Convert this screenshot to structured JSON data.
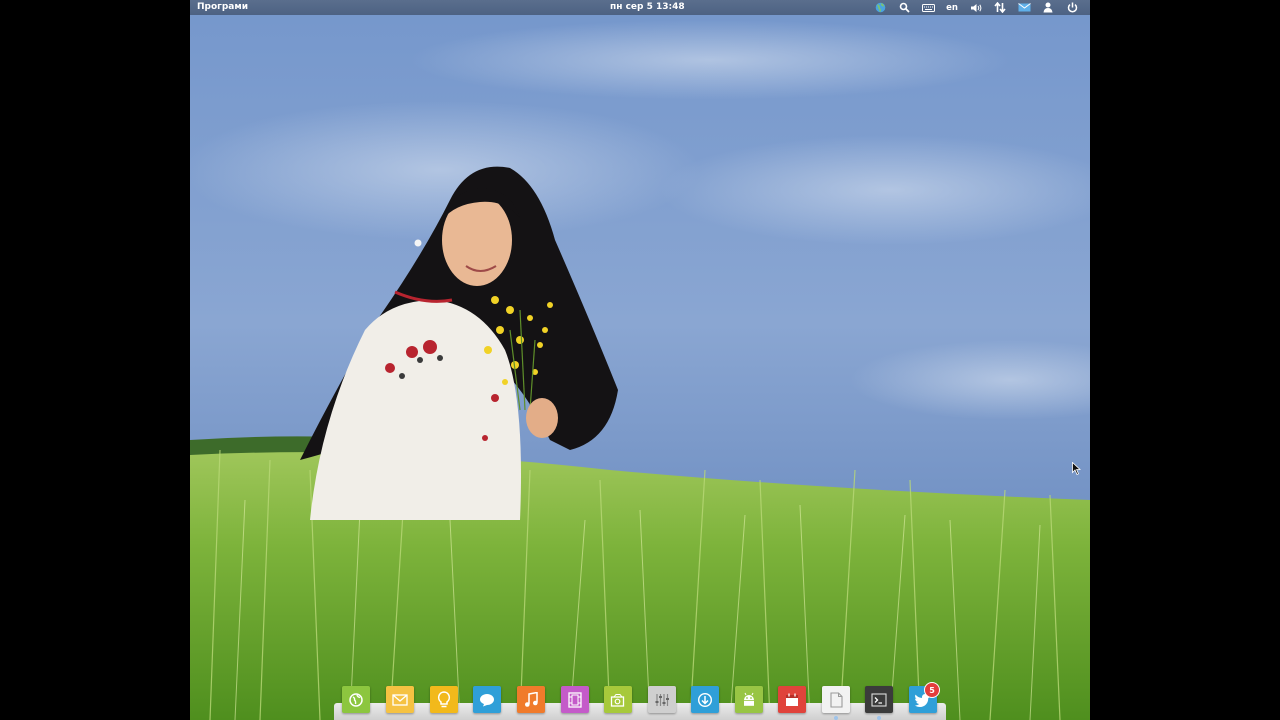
{
  "panel": {
    "applications_label": "Програми",
    "clock": "пн сер  5 13:48",
    "indicators": [
      {
        "name": "network-globe-icon"
      },
      {
        "name": "search-icon"
      },
      {
        "name": "keyboard-icon"
      },
      {
        "name": "language",
        "label": "en"
      },
      {
        "name": "volume-icon"
      },
      {
        "name": "network-transfer-icon"
      },
      {
        "name": "mail-icon"
      },
      {
        "name": "user-icon"
      },
      {
        "name": "power-icon"
      }
    ]
  },
  "dock": {
    "items": [
      {
        "name": "browser",
        "icon": "globe-icon",
        "color": "#8cc63f"
      },
      {
        "name": "mail",
        "icon": "envelope-icon",
        "color": "#f5c242"
      },
      {
        "name": "tips",
        "icon": "lightbulb-icon",
        "color": "#f2b91b"
      },
      {
        "name": "messaging",
        "icon": "chat-bubble-icon",
        "color": "#2f9fd8"
      },
      {
        "name": "music",
        "icon": "music-note-icon",
        "color": "#f07b2b"
      },
      {
        "name": "video",
        "icon": "film-icon",
        "color": "#c45bc9"
      },
      {
        "name": "photos",
        "icon": "photo-icon",
        "color": "#a7c93b"
      },
      {
        "name": "settings",
        "icon": "sliders-icon",
        "color": "#cfcfcf"
      },
      {
        "name": "software-center",
        "icon": "download-icon",
        "color": "#2f9fd8"
      },
      {
        "name": "android",
        "icon": "robot-icon",
        "color": "#98c544"
      },
      {
        "name": "calendar",
        "icon": "calendar-icon",
        "color": "#e0433b"
      },
      {
        "name": "text-editor",
        "icon": "document-icon",
        "color": "#f2f2f2"
      },
      {
        "name": "terminal",
        "icon": "terminal-icon",
        "color": "#3b3b3b"
      },
      {
        "name": "twitter",
        "icon": "bird-icon",
        "color": "#2f9fd8",
        "badge": "5"
      }
    ]
  }
}
